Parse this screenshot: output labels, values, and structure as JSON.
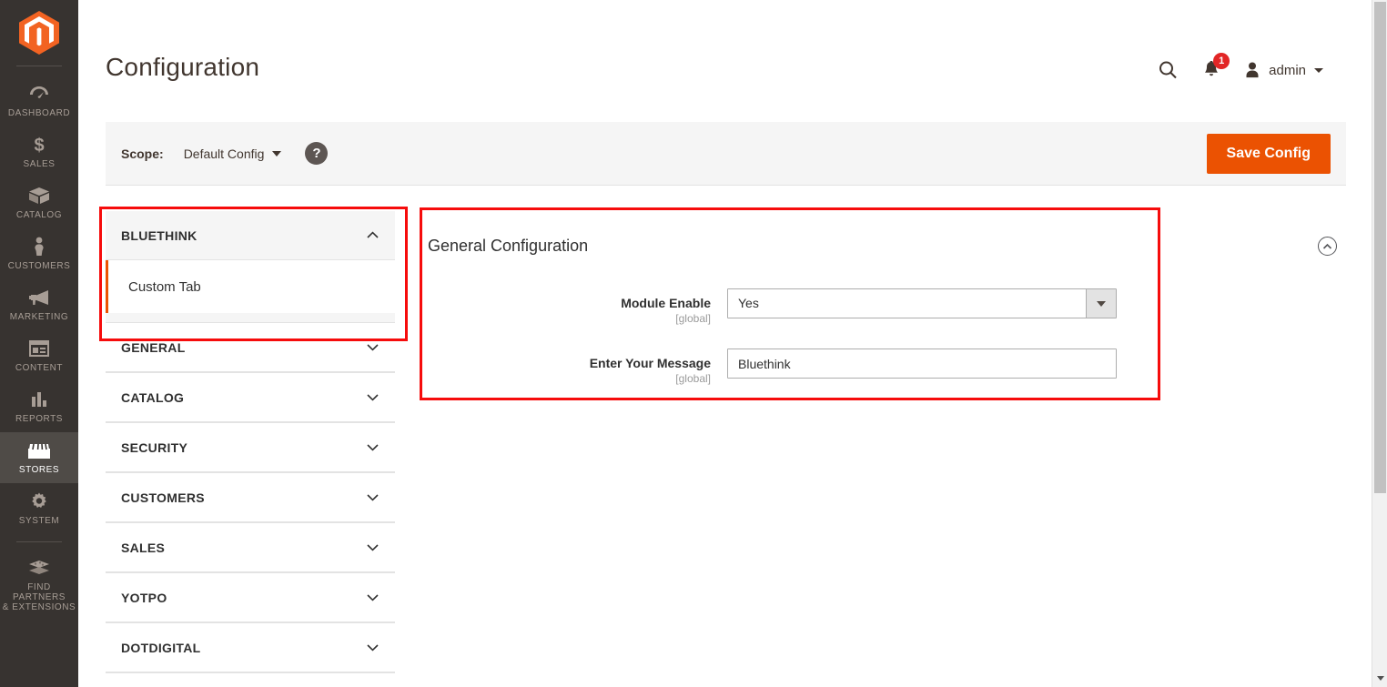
{
  "sidebar": {
    "logo": "magento-logo",
    "items": [
      {
        "label": "Dashboard",
        "icon": "dashboard-icon",
        "active": false
      },
      {
        "label": "Sales",
        "icon": "dollar-icon",
        "active": false
      },
      {
        "label": "Catalog",
        "icon": "box-icon",
        "active": false
      },
      {
        "label": "Customers",
        "icon": "person-icon",
        "active": false
      },
      {
        "label": "Marketing",
        "icon": "megaphone-icon",
        "active": false
      },
      {
        "label": "Content",
        "icon": "layout-icon",
        "active": false
      },
      {
        "label": "Reports",
        "icon": "bar-chart-icon",
        "active": false
      },
      {
        "label": "Stores",
        "icon": "store-icon",
        "active": true
      },
      {
        "label": "System",
        "icon": "gear-icon",
        "active": false
      },
      {
        "label": "Find Partners\n& Extensions",
        "icon": "extensions-icon",
        "active": false
      }
    ],
    "find_partners_line1": "FIND PARTNERS",
    "find_partners_line2": "& EXTENSIONS"
  },
  "header": {
    "title": "Configuration",
    "search_icon": "search-icon",
    "notification_icon": "bell-icon",
    "notification_count": "1",
    "avatar_icon": "user-icon",
    "admin_name": "admin"
  },
  "scope_bar": {
    "label": "Scope:",
    "selected": "Default Config",
    "help_glyph": "?",
    "save_label": "Save Config"
  },
  "config_nav": {
    "sections": [
      {
        "title": "BLUETHINK",
        "expanded": true,
        "chevron": "chevron-up-icon",
        "children": [
          {
            "label": "Custom Tab",
            "active": true
          }
        ]
      },
      {
        "title": "GENERAL",
        "expanded": false,
        "chevron": "chevron-down-icon",
        "children": []
      },
      {
        "title": "CATALOG",
        "expanded": false,
        "chevron": "chevron-down-icon",
        "children": []
      },
      {
        "title": "SECURITY",
        "expanded": false,
        "chevron": "chevron-down-icon",
        "children": []
      },
      {
        "title": "CUSTOMERS",
        "expanded": false,
        "chevron": "chevron-down-icon",
        "children": []
      },
      {
        "title": "SALES",
        "expanded": false,
        "chevron": "chevron-down-icon",
        "children": []
      },
      {
        "title": "YOTPO",
        "expanded": false,
        "chevron": "chevron-down-icon",
        "children": []
      },
      {
        "title": "DOTDIGITAL",
        "expanded": false,
        "chevron": "chevron-down-icon",
        "children": []
      }
    ]
  },
  "config_panel": {
    "title": "General Configuration",
    "collapse_icon": "chevron-up-circle-icon",
    "fields": [
      {
        "label": "Module Enable",
        "scope": "[global]",
        "type": "select",
        "value": "Yes"
      },
      {
        "label": "Enter Your Message",
        "scope": "[global]",
        "type": "text",
        "value": "Bluethink"
      }
    ]
  },
  "colors": {
    "accent_orange": "#eb5202",
    "sidebar_bg": "#373330",
    "annotation_red": "#f60c0c",
    "badge_red": "#e22626"
  },
  "scrollbar": {
    "name": "vertical-scrollbar"
  }
}
